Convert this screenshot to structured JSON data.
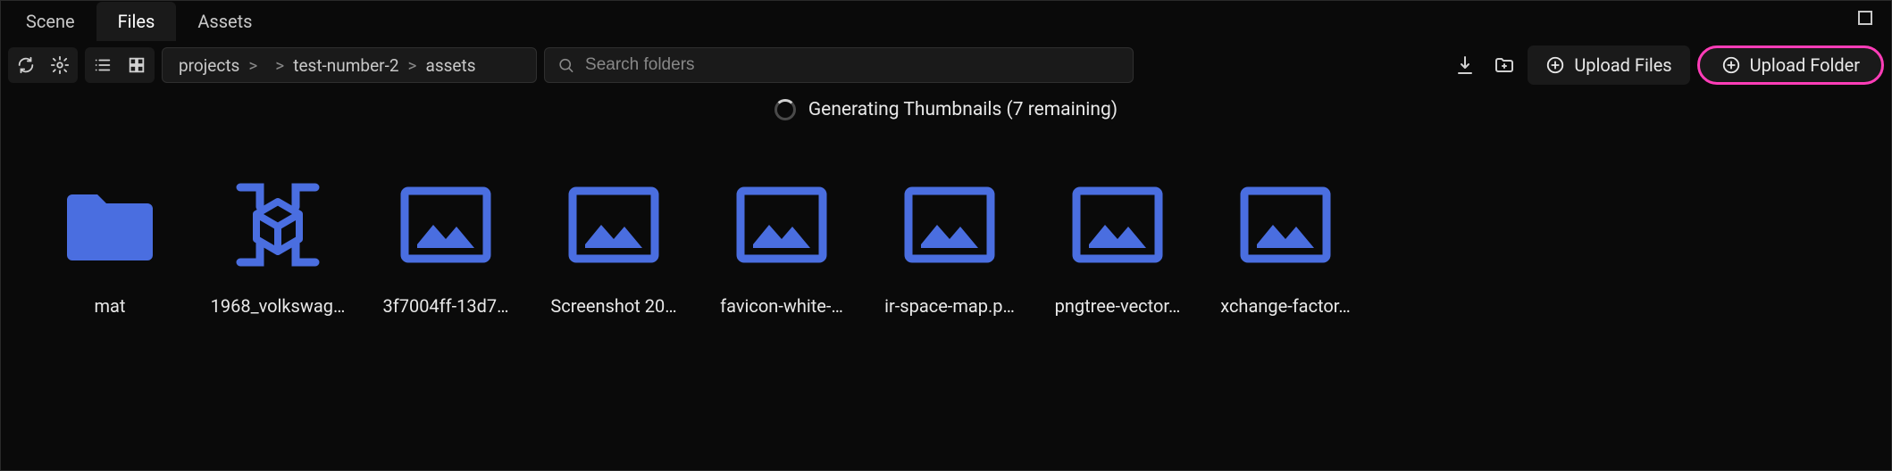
{
  "tabs": {
    "scene": "Scene",
    "files": "Files",
    "assets": "Assets",
    "active": "files"
  },
  "breadcrumb": {
    "items": [
      "projects",
      "",
      "test-number-2",
      "assets"
    ]
  },
  "search": {
    "placeholder": "Search folders",
    "value": ""
  },
  "actions": {
    "upload_files": "Upload Files",
    "upload_folder": "Upload Folder"
  },
  "status": {
    "text": "Generating Thumbnails (7 remaining)"
  },
  "colors": {
    "accent": "#4a6ee0",
    "highlight": "#ff3db8"
  },
  "items": [
    {
      "name": "mat",
      "type": "folder"
    },
    {
      "name": "1968_volkswag…",
      "type": "model"
    },
    {
      "name": "3f7004ff-13d7…",
      "type": "image"
    },
    {
      "name": "Screenshot 20…",
      "type": "image"
    },
    {
      "name": "favicon-white-…",
      "type": "image"
    },
    {
      "name": "ir-space-map.p…",
      "type": "image"
    },
    {
      "name": "pngtree-vector…",
      "type": "image"
    },
    {
      "name": "xchange-factor…",
      "type": "image"
    }
  ]
}
